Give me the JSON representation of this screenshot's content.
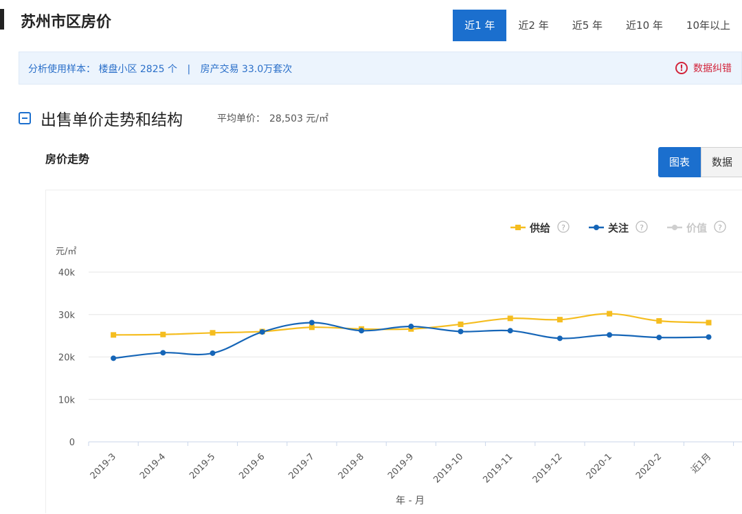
{
  "page_title": "苏州市区房价",
  "tabs": [
    {
      "label": "近1 年",
      "active": true
    },
    {
      "label": "近2 年",
      "active": false
    },
    {
      "label": "近5 年",
      "active": false
    },
    {
      "label": "近10 年",
      "active": false
    },
    {
      "label": "10年以上",
      "active": false
    }
  ],
  "info": {
    "sample_label": "分析使用样本：",
    "community": "楼盘小区 2825 个",
    "separator": "|",
    "transactions": "房产交易 33.0万套次",
    "error_report": "数据纠错",
    "error_icon": "alert-circle-icon"
  },
  "section": {
    "title": "出售单价走势和结构",
    "avg_label": "平均单价：",
    "avg_value": "28,503 元/㎡"
  },
  "chart_section_title": "房价走势",
  "view_toggle": {
    "chart": "图表",
    "data": "数据"
  },
  "colors": {
    "accent": "#1b6fce",
    "supply": "#f5bd1f",
    "attention": "#1565b7",
    "value": "#cfcfcf",
    "error": "#d2233a"
  },
  "chart_data": {
    "type": "line",
    "categories": [
      "2019-3",
      "2019-4",
      "2019-5",
      "2019-6",
      "2019-7",
      "2019-8",
      "2019-9",
      "2019-10",
      "2019-11",
      "2019-12",
      "2020-1",
      "2020-2",
      "近1月"
    ],
    "series": [
      {
        "name": "供给",
        "marker": "square",
        "color": "#f5bd1f",
        "enabled": true,
        "values": [
          25200,
          25300,
          25700,
          26000,
          27000,
          26600,
          26600,
          27700,
          29100,
          28800,
          30200,
          28500,
          28100
        ]
      },
      {
        "name": "关注",
        "marker": "circle",
        "color": "#1565b7",
        "enabled": true,
        "values": [
          19700,
          21000,
          20900,
          25900,
          28100,
          26200,
          27200,
          26000,
          26200,
          24400,
          25200,
          24600,
          24700
        ]
      },
      {
        "name": "价值",
        "marker": "circle",
        "color": "#cfcfcf",
        "enabled": false,
        "values": []
      }
    ],
    "unit_label": "元/㎡",
    "xlabel": "年 - 月",
    "ylim": [
      0,
      40000
    ],
    "yticks": [
      0,
      10000,
      20000,
      30000,
      40000
    ],
    "ytick_labels": [
      "0",
      "10k",
      "20k",
      "30k",
      "40k"
    ],
    "grid": true,
    "legend_position": "top-right",
    "legend_help_glyph": "?"
  }
}
